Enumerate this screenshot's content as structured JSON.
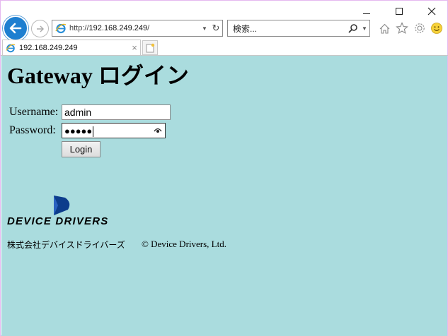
{
  "browser": {
    "address": {
      "scheme": "http://",
      "host": "192.168.249.249",
      "path": "/"
    },
    "search": {
      "placeholder": "検索..."
    },
    "tab": {
      "label": "192.168.249.249"
    },
    "colors": {
      "back_button": "#1e7fd0",
      "page_background": "#aadcde"
    }
  },
  "page": {
    "title": "Gateway ログイン",
    "form": {
      "username_label": "Username:",
      "username_value": "admin",
      "password_label": "Password:",
      "password_masked": "●●●●●",
      "login_label": "Login"
    },
    "logo": {
      "text": "DEVICE DRIVERS",
      "color": "#0d3d8c"
    },
    "footer": {
      "company": "株式会社デバイスドライバーズ",
      "copyright": "© Device Drivers, Ltd."
    }
  }
}
